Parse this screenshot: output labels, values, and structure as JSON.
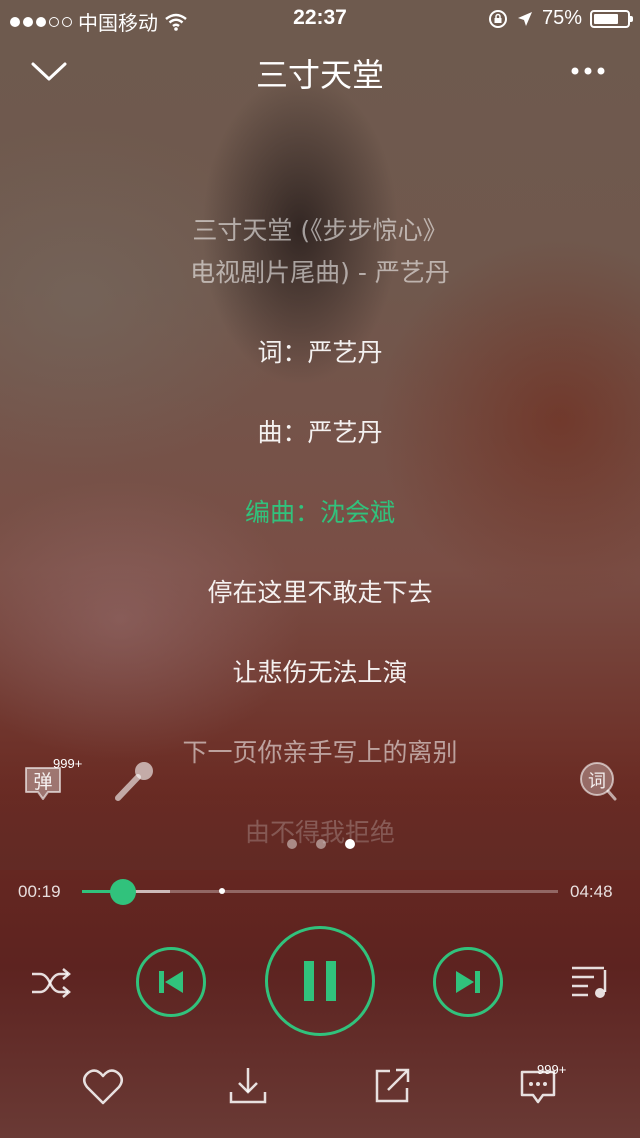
{
  "status": {
    "carrier": "中国移动",
    "time": "22:37",
    "battery": "75%",
    "battery_level": 0.75
  },
  "header": {
    "title": "三寸天堂"
  },
  "lyrics": [
    {
      "text": "三寸天堂 (《步步惊心》",
      "state": "dim"
    },
    {
      "text": "电视剧片尾曲) - 严艺丹",
      "state": "dim"
    },
    {
      "text": "词：严艺丹",
      "state": "normal"
    },
    {
      "text": "曲：严艺丹",
      "state": "normal"
    },
    {
      "text": "编曲：沈会斌",
      "state": "current"
    },
    {
      "text": "停在这里不敢走下去",
      "state": "normal"
    },
    {
      "text": "让悲伤无法上演",
      "state": "normal"
    },
    {
      "text": "下一页你亲手写上的离别",
      "state": "dim"
    },
    {
      "text": "由不得我拒绝",
      "state": "fade"
    }
  ],
  "side": {
    "danmu_label": "弹",
    "danmu_count": "999+",
    "lyric_search_label": "词"
  },
  "pager": {
    "count": 3,
    "active": 3
  },
  "progress": {
    "elapsed": "00:19",
    "total": "04:48",
    "played_fraction": 0.086,
    "buffered_fraction": 0.185
  },
  "comments": {
    "count": "999+"
  },
  "icons": [
    "chevron-down-icon",
    "more-icon",
    "danmu-icon",
    "microphone-icon",
    "lyric-search-icon",
    "shuffle-icon",
    "previous-icon",
    "pause-icon",
    "next-icon",
    "playlist-icon",
    "heart-icon",
    "download-icon",
    "share-icon",
    "comment-icon"
  ],
  "colors": {
    "accent": "#31c27c"
  }
}
